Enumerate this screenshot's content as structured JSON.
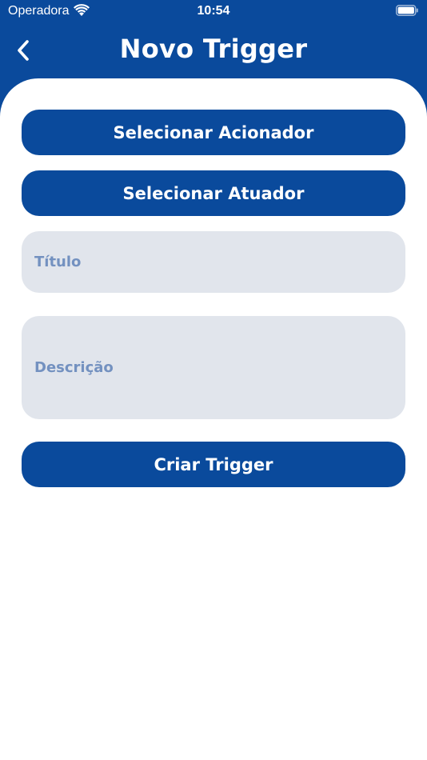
{
  "status_bar": {
    "carrier": "Operadora",
    "time": "10:54",
    "wifi_icon": "wifi-icon",
    "battery_icon": "battery-icon"
  },
  "header": {
    "title": "Novo Trigger",
    "back_icon": "chevron-left-icon"
  },
  "form": {
    "select_trigger_label": "Selecionar Acionador",
    "select_actuator_label": "Selecionar Atuador",
    "title_placeholder": "Título",
    "description_placeholder": "Descrição",
    "create_label": "Criar Trigger"
  },
  "colors": {
    "primary": "#0a4a9c",
    "field_bg": "#e1e5ec",
    "placeholder": "#7391c0",
    "background": "#ffffff"
  }
}
